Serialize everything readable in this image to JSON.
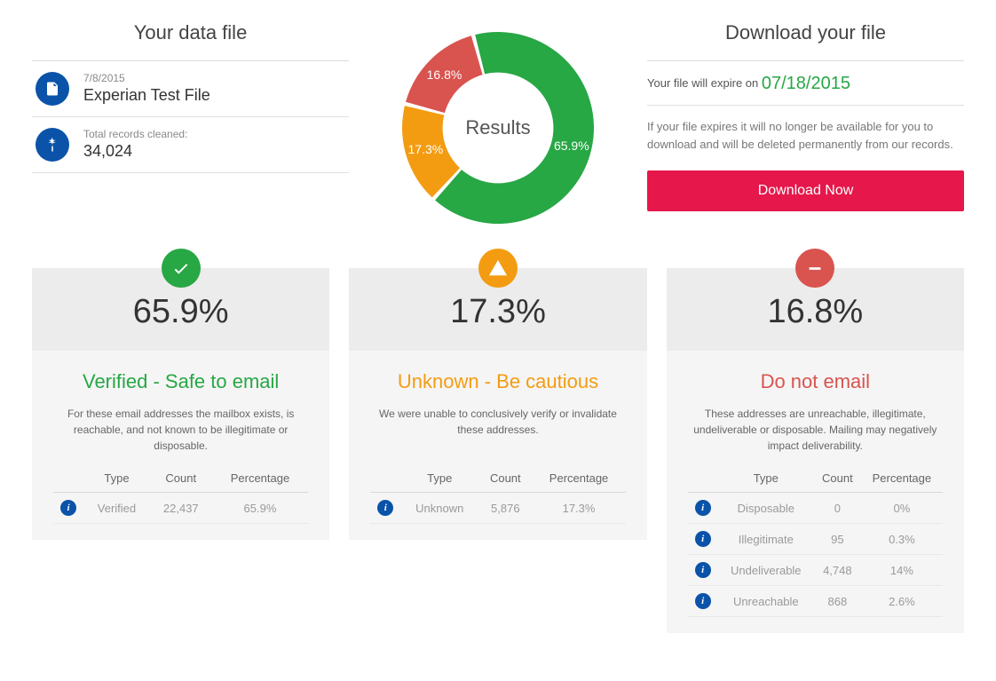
{
  "colors": {
    "green": "#28a745",
    "orange": "#f39c12",
    "red": "#d9534f",
    "blue": "#0a53a8",
    "pink": "#e5174b"
  },
  "data_file_panel": {
    "title": "Your data file",
    "date": "7/8/2015",
    "filename": "Experian Test File",
    "records_label": "Total records cleaned:",
    "records_value": "34,024"
  },
  "chart_data": {
    "type": "pie",
    "center_label": "Results",
    "slices": [
      {
        "label": "Verified",
        "pct": 65.9,
        "display": "65.9%",
        "color": "#28a745"
      },
      {
        "label": "Unknown",
        "pct": 17.3,
        "display": "17.3%",
        "color": "#f39c12"
      },
      {
        "label": "Do not email",
        "pct": 16.8,
        "display": "16.8%",
        "color": "#d9534f"
      }
    ]
  },
  "download_panel": {
    "title": "Download your file",
    "expire_prefix": "Your file will expire on ",
    "expire_date": "07/18/2015",
    "note": "If your file expires it will no longer be available for you to download and will be deleted permanently from our records.",
    "button": "Download Now"
  },
  "table_headers": {
    "type": "Type",
    "count": "Count",
    "pct": "Percentage"
  },
  "cards": {
    "verified": {
      "pct": "65.9%",
      "title": "Verified - Safe to email",
      "desc": "For these email addresses the mailbox exists, is reachable, and not known to be illegitimate or disposable.",
      "rows": [
        {
          "type": "Verified",
          "count": "22,437",
          "pct": "65.9%"
        }
      ]
    },
    "unknown": {
      "pct": "17.3%",
      "title": "Unknown - Be cautious",
      "desc": "We were unable to conclusively verify or invalidate these addresses.",
      "rows": [
        {
          "type": "Unknown",
          "count": "5,876",
          "pct": "17.3%"
        }
      ]
    },
    "donot": {
      "pct": "16.8%",
      "title": "Do not email",
      "desc": "These addresses are unreachable, illegitimate, undeliverable or disposable. Mailing may negatively impact deliverability.",
      "rows": [
        {
          "type": "Disposable",
          "count": "0",
          "pct": "0%"
        },
        {
          "type": "Illegitimate",
          "count": "95",
          "pct": "0.3%"
        },
        {
          "type": "Undeliverable",
          "count": "4,748",
          "pct": "14%"
        },
        {
          "type": "Unreachable",
          "count": "868",
          "pct": "2.6%"
        }
      ]
    }
  }
}
